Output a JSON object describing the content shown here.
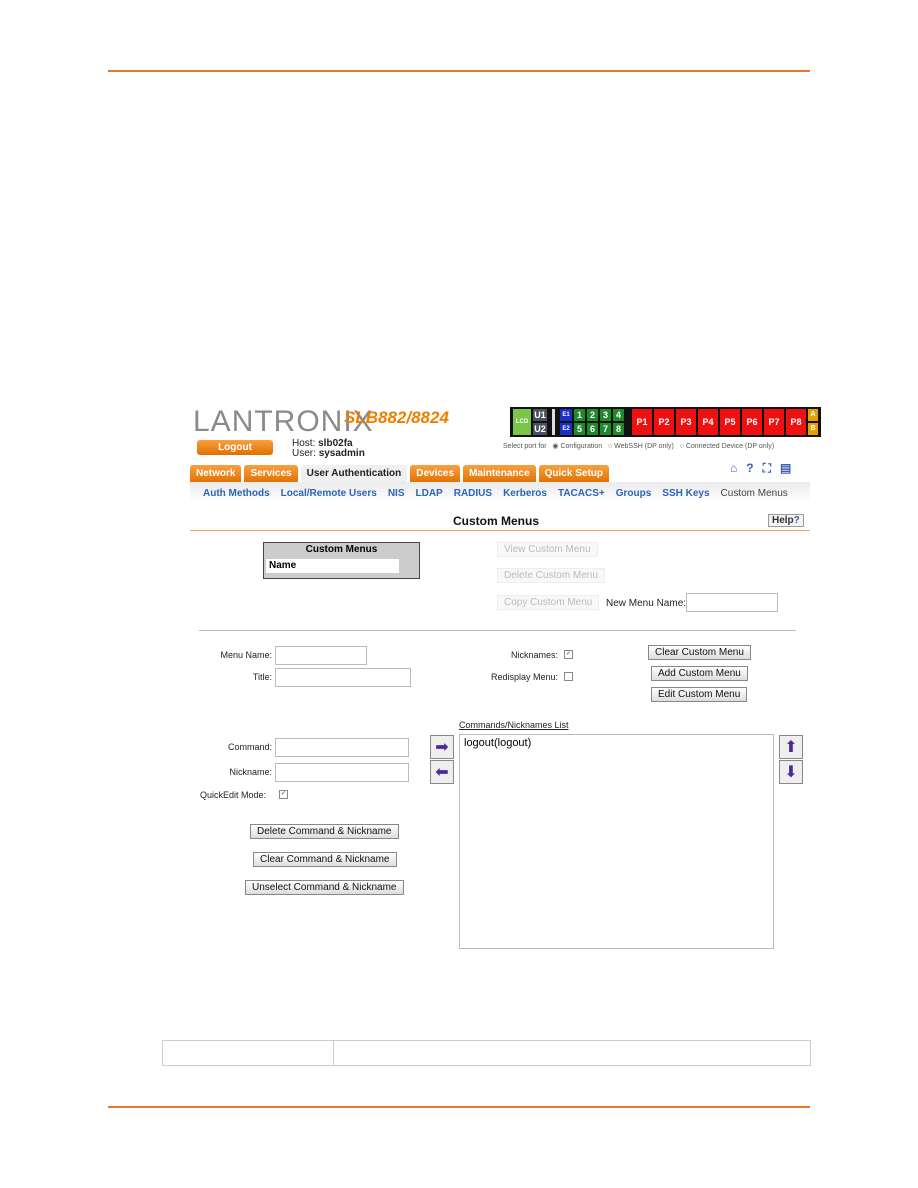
{
  "header": {
    "brand": "LANTRONIX",
    "model": "SLB882/8824",
    "logout_label": "Logout",
    "host_label": "Host:",
    "host_value": "slb02fa",
    "user_label": "User:",
    "user_value": "sysadmin"
  },
  "ports": {
    "lcd": "LCD",
    "u": [
      "U1",
      "U2"
    ],
    "e": [
      "E1",
      "E2"
    ],
    "device_ports": [
      "1",
      "2",
      "3",
      "4",
      "5",
      "6",
      "7",
      "8"
    ],
    "serial_ports": [
      "P1",
      "P2",
      "P3",
      "P4",
      "P5",
      "P6",
      "P7",
      "P8"
    ],
    "ab": [
      "A",
      "B"
    ],
    "select_label": "Select port for",
    "options": [
      {
        "label": "Configuration",
        "selected": true
      },
      {
        "label": "WebSSH (DP only)",
        "selected": false
      },
      {
        "label": "Connected Device (DP only)",
        "selected": false
      }
    ],
    "colors": {
      "lcd": "#7cc44a",
      "eth": "#1a2ec8",
      "device": "#1f8a2a",
      "serial": "#ee1111",
      "ab": "#e8a000"
    }
  },
  "tabs": [
    {
      "label": "Network",
      "active": false
    },
    {
      "label": "Services",
      "active": false
    },
    {
      "label": "User Authentication",
      "active": true
    },
    {
      "label": "Devices",
      "active": false
    },
    {
      "label": "Maintenance",
      "active": false
    },
    {
      "label": "Quick Setup",
      "active": false
    }
  ],
  "toolbar_icons": [
    "home-icon",
    "help-icon",
    "sitemap-icon",
    "log-icon"
  ],
  "subnav": [
    "Auth Methods",
    "Local/Remote Users",
    "NIS",
    "LDAP",
    "RADIUS",
    "Kerberos",
    "TACACS+",
    "Groups",
    "SSH Keys",
    "Custom Menus"
  ],
  "page": {
    "title": "Custom Menus",
    "help_label": "Help"
  },
  "custom_menus_box": {
    "header": "Custom Menus",
    "column": "Name"
  },
  "top_buttons": {
    "view": "View Custom Menu",
    "delete": "Delete Custom Menu",
    "copy": "Copy Custom Menu",
    "new_menu_name_label": "New Menu Name:",
    "new_menu_name_value": ""
  },
  "form": {
    "menu_name_label": "Menu Name:",
    "menu_name_value": "",
    "title_label": "Title:",
    "title_value": "",
    "nicknames_label": "Nicknames:",
    "nicknames_checked": true,
    "redisplay_label": "Redisplay Menu:",
    "redisplay_checked": false,
    "clear_menu": "Clear Custom Menu",
    "add_menu": "Add Custom Menu",
    "edit_menu": "Edit Custom Menu",
    "command_label": "Command:",
    "command_value": "",
    "nickname_label": "Nickname:",
    "nickname_value": "",
    "quickedit_label": "QuickEdit Mode:",
    "quickedit_checked": true,
    "delete_cmd": "Delete Command & Nickname",
    "clear_cmd": "Clear Command & Nickname",
    "unselect_cmd": "Unselect Command & Nickname"
  },
  "list": {
    "header": "Commands/Nicknames List",
    "items": [
      "logout(logout)"
    ]
  }
}
